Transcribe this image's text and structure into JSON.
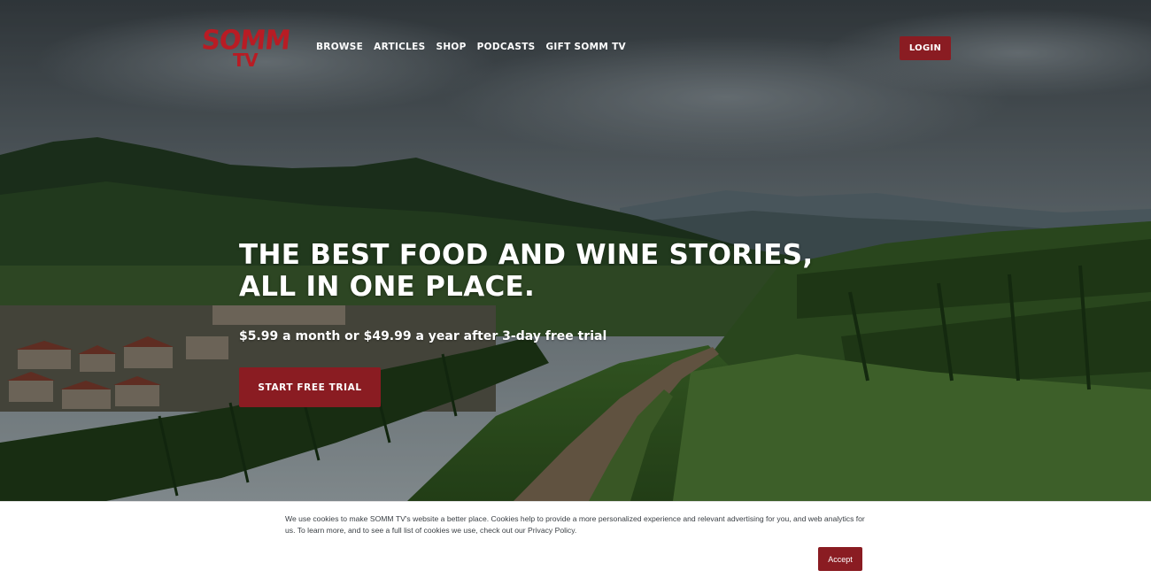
{
  "logo": {
    "line1": "SOMM",
    "line2": "TV"
  },
  "nav": {
    "items": [
      "BROWSE",
      "ARTICLES",
      "SHOP",
      "PODCASTS",
      "GIFT SOMM TV"
    ]
  },
  "header": {
    "login_label": "LOGIN"
  },
  "hero": {
    "headline_line1": "THE BEST FOOD AND WINE STORIES,",
    "headline_line2": "ALL IN ONE PLACE.",
    "pricing": "$5.99 a month or $49.99 a year after 3-day free trial",
    "cta_label": "START FREE TRIAL"
  },
  "cookie_banner": {
    "text": "We use cookies to make SOMM TV's website a better place. Cookies help to provide a more personalized experience and relevant advertising for you, and web analytics for us. To learn more, and to see a full list of cookies we use, check out our Privacy Policy.",
    "accept_label": "Accept"
  },
  "colors": {
    "brand": "#b81c24",
    "button": "#8a1c22",
    "banner_bg": "#ffffff"
  },
  "hero_image": "vineyard-landscape"
}
